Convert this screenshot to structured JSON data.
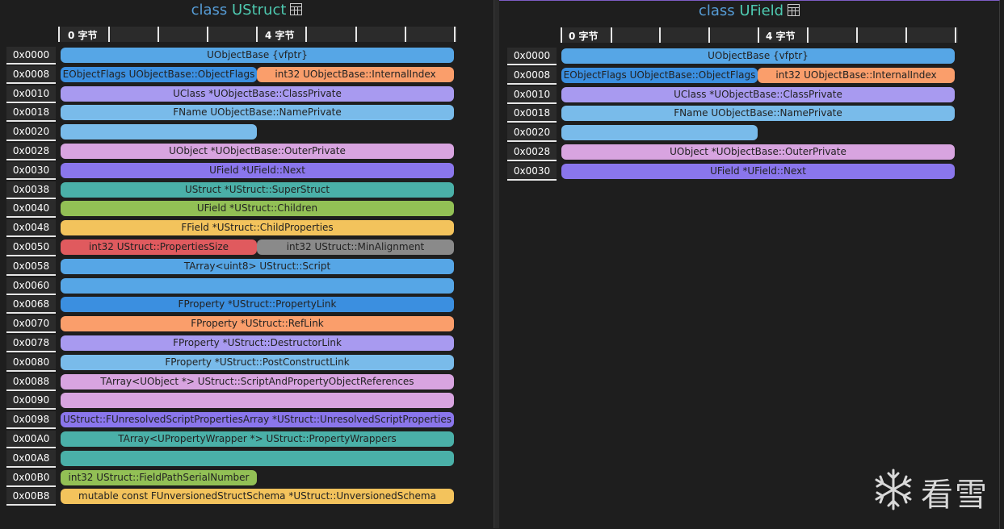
{
  "panels": {
    "left": {
      "title_kw": "class",
      "title_name": "UStruct",
      "ruler": {
        "label0": "0 字节",
        "label4": "4 字节"
      },
      "rows": [
        {
          "offset": "0x0000",
          "fields": [
            {
              "label": "UObjectBase {vfptr}",
              "span": "full",
              "color": "#56a6e6"
            }
          ]
        },
        {
          "offset": "0x0008",
          "fields": [
            {
              "label": "EObjectFlags UObjectBase::ObjectFlags",
              "span": "half",
              "color": "#3b8fe0"
            },
            {
              "label": "int32 UObjectBase::InternalIndex",
              "span": "half2",
              "color": "#fa9e6b"
            }
          ]
        },
        {
          "offset": "0x0010",
          "fields": [
            {
              "label": "UClass *UObjectBase::ClassPrivate",
              "span": "full",
              "color": "#a89af0"
            }
          ]
        },
        {
          "offset": "0x0018",
          "fields": [
            {
              "label": "FName UObjectBase::NamePrivate",
              "span": "full",
              "color": "#79bbea"
            }
          ]
        },
        {
          "offset": "0x0020",
          "fields": [
            {
              "label": "",
              "span": "half",
              "color": "#79bbea"
            }
          ]
        },
        {
          "offset": "0x0028",
          "fields": [
            {
              "label": "UObject *UObjectBase::OuterPrivate",
              "span": "full",
              "color": "#d8a4e0"
            }
          ]
        },
        {
          "offset": "0x0030",
          "fields": [
            {
              "label": "UField *UField::Next",
              "span": "full",
              "color": "#8a76ec"
            }
          ]
        },
        {
          "offset": "0x0038",
          "fields": [
            {
              "label": "UStruct *UStruct::SuperStruct",
              "span": "full",
              "color": "#4ab0a8"
            }
          ]
        },
        {
          "offset": "0x0040",
          "fields": [
            {
              "label": "UField *UStruct::Children",
              "span": "full",
              "color": "#92c055"
            }
          ]
        },
        {
          "offset": "0x0048",
          "fields": [
            {
              "label": "FField *UStruct::ChildProperties",
              "span": "full",
              "color": "#f3c35c"
            }
          ]
        },
        {
          "offset": "0x0050",
          "fields": [
            {
              "label": "int32 UStruct::PropertiesSize",
              "span": "half",
              "color": "#e05a5e"
            },
            {
              "label": "int32 UStruct::MinAlignment",
              "span": "half2",
              "color": "#8a8a8a"
            }
          ]
        },
        {
          "offset": "0x0058",
          "fields": [
            {
              "label": "TArray<uint8> UStruct::Script",
              "span": "full",
              "color": "#56a6e6"
            }
          ]
        },
        {
          "offset": "0x0060",
          "fields": [
            {
              "label": "",
              "span": "full",
              "color": "#56a6e6"
            }
          ]
        },
        {
          "offset": "0x0068",
          "fields": [
            {
              "label": "FProperty *UStruct::PropertyLink",
              "span": "full",
              "color": "#3b8fe0"
            }
          ]
        },
        {
          "offset": "0x0070",
          "fields": [
            {
              "label": "FProperty *UStruct::RefLink",
              "span": "full",
              "color": "#fa9e6b"
            }
          ]
        },
        {
          "offset": "0x0078",
          "fields": [
            {
              "label": "FProperty *UStruct::DestructorLink",
              "span": "full",
              "color": "#a89af0"
            }
          ]
        },
        {
          "offset": "0x0080",
          "fields": [
            {
              "label": "FProperty *UStruct::PostConstructLink",
              "span": "full",
              "color": "#79bbea"
            }
          ]
        },
        {
          "offset": "0x0088",
          "fields": [
            {
              "label": "TArray<UObject *> UStruct::ScriptAndPropertyObjectReferences",
              "span": "full",
              "color": "#d8a4e0"
            }
          ]
        },
        {
          "offset": "0x0090",
          "fields": [
            {
              "label": "",
              "span": "full",
              "color": "#d8a4e0"
            }
          ]
        },
        {
          "offset": "0x0098",
          "fields": [
            {
              "label": "UStruct::FUnresolvedScriptPropertiesArray *UStruct::UnresolvedScriptProperties",
              "span": "full",
              "color": "#8a76ec"
            }
          ]
        },
        {
          "offset": "0x00A0",
          "fields": [
            {
              "label": "TArray<UPropertyWrapper *> UStruct::PropertyWrappers",
              "span": "full",
              "color": "#4ab0a8"
            }
          ]
        },
        {
          "offset": "0x00A8",
          "fields": [
            {
              "label": "",
              "span": "full",
              "color": "#4ab0a8"
            }
          ]
        },
        {
          "offset": "0x00B0",
          "fields": [
            {
              "label": "int32 UStruct::FieldPathSerialNumber",
              "span": "half",
              "color": "#92c055"
            }
          ]
        },
        {
          "offset": "0x00B8",
          "fields": [
            {
              "label": "mutable const FUnversionedStructSchema *UStruct::UnversionedSchema",
              "span": "full",
              "color": "#f3c35c"
            }
          ]
        }
      ]
    },
    "right": {
      "title_kw": "class",
      "title_name": "UField",
      "ruler": {
        "label0": "0 字节",
        "label4": "4 字节"
      },
      "rows": [
        {
          "offset": "0x0000",
          "fields": [
            {
              "label": "UObjectBase {vfptr}",
              "span": "full",
              "color": "#56a6e6"
            }
          ]
        },
        {
          "offset": "0x0008",
          "fields": [
            {
              "label": "EObjectFlags UObjectBase::ObjectFlags",
              "span": "half",
              "color": "#3b8fe0"
            },
            {
              "label": "int32 UObjectBase::InternalIndex",
              "span": "half2",
              "color": "#fa9e6b"
            }
          ]
        },
        {
          "offset": "0x0010",
          "fields": [
            {
              "label": "UClass *UObjectBase::ClassPrivate",
              "span": "full",
              "color": "#a89af0"
            }
          ]
        },
        {
          "offset": "0x0018",
          "fields": [
            {
              "label": "FName UObjectBase::NamePrivate",
              "span": "full",
              "color": "#79bbea"
            }
          ]
        },
        {
          "offset": "0x0020",
          "fields": [
            {
              "label": "",
              "span": "half",
              "color": "#79bbea"
            }
          ]
        },
        {
          "offset": "0x0028",
          "fields": [
            {
              "label": "UObject *UObjectBase::OuterPrivate",
              "span": "full",
              "color": "#d8a4e0"
            }
          ]
        },
        {
          "offset": "0x0030",
          "fields": [
            {
              "label": "UField *UField::Next",
              "span": "full",
              "color": "#8a76ec"
            }
          ]
        }
      ]
    }
  },
  "watermark": {
    "text": "看雪",
    "icon": "snowflake-icon"
  }
}
